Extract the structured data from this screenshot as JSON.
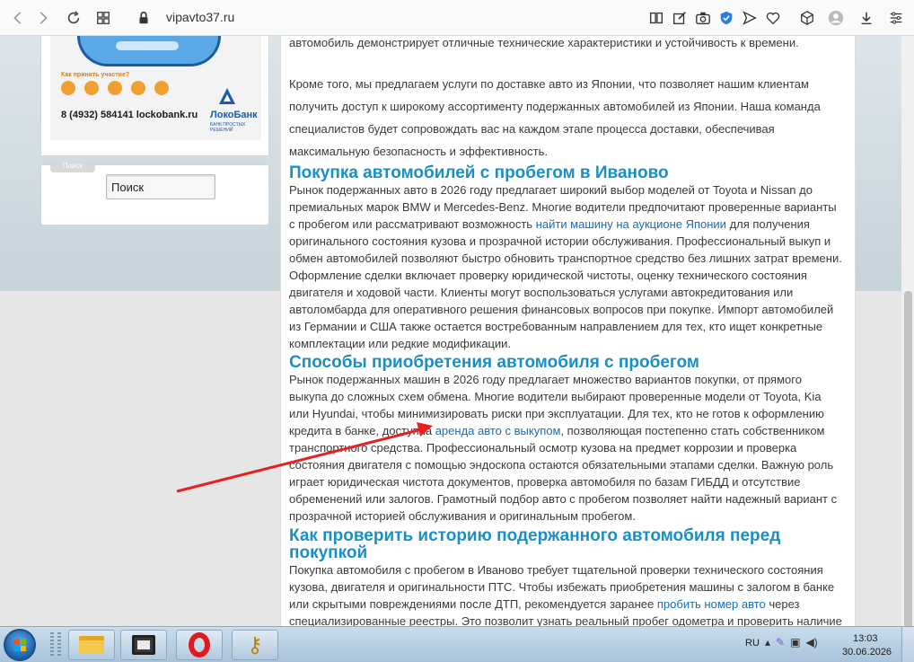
{
  "browser": {
    "url": "vipavto37.ru",
    "icons": [
      "back-icon",
      "forward-icon",
      "reload-icon",
      "tabs-grid-icon",
      "lock-icon",
      "reader-icon",
      "edit-icon",
      "camera-icon",
      "shield-icon",
      "send-icon",
      "heart-icon",
      "cube-icon",
      "profile-icon",
      "download-icon",
      "settings-icon"
    ]
  },
  "sidebar": {
    "banner": {
      "question": "Как принять участие?",
      "phone": "8 (4932) 584141 lockobank.ru",
      "bank_name": "ЛокоБанк",
      "bank_slogan": "БАНК ПРОСТЫХ РЕШЕНИЙ"
    },
    "search": {
      "tab_label": "Поиск",
      "placeholder": "Поиск"
    }
  },
  "article": {
    "intro_tail": "автомобиль демонстрирует отличные технические характеристики и устойчивость к времени.",
    "intro_para": "Кроме того, мы предлагаем услуги по доставке авто из Японии, что позволяет нашим клиентам получить доступ к широкому ассортименту подержанных автомобилей из Японии. Наша команда специалистов будет сопровождать вас на каждом этапе процесса доставки, обеспечивая максимальную безопасность и эффективность.",
    "sections": [
      {
        "title": "Покупка автомобилей с пробегом в Иваново",
        "text_before": "Рынок подержанных авто в 2026 году предлагает широкий выбор моделей от Toyota и Nissan до премиальных марок BMW и Mercedes-Benz. Многие водители предпочитают проверенные варианты с пробегом или рассматривают возможность ",
        "link": "найти машину на аукционе Японии",
        "text_after": " для получения оригинального состояния кузова и прозрачной истории обслуживания. Профессиональный выкуп и обмен автомобилей позволяют быстро обновить транспортное средство без лишних затрат времени. Оформление сделки включает проверку юридической чистоты, оценку технического состояния двигателя и ходовой части. Клиенты могут воспользоваться услугами автокредитования или автоломбарда для оперативного решения финансовых вопросов при покупке. Импорт автомобилей из Германии и США также остается востребованным направлением для тех, кто ищет конкретные комплектации или редкие модификации."
      },
      {
        "title": "Способы приобретения автомобиля с пробегом",
        "text_before": "Рынок подержанных машин в 2026 году предлагает множество вариантов покупки, от прямого выкупа до сложных схем обмена. Многие водители выбирают проверенные модели от Toyota, Kia или Hyundai, чтобы минимизировать риски при эксплуатации. Для тех, кто не готов к оформлению кредита в банке, доступна ",
        "link": "аренда авто с выкупом",
        "text_after": ", позволяющая постепенно стать собственником транспортного средства. Профессиональный осмотр кузова на предмет коррозии и проверка состояния двигателя с помощью эндоскопа остаются обязательными этапами сделки. Важную роль играет юридическая чистота документов, проверка автомобиля по базам ГИБДД и отсутствие обременений или залогов. Грамотный подбор авто с пробегом позволяет найти надежный вариант с прозрачной историей обслуживания и оригинальным пробегом."
      },
      {
        "title": "Как проверить историю подержанного автомобиля перед покупкой",
        "text_before": "Покупка автомобиля с пробегом в Иваново требует тщательной проверки технического состояния кузова, двигателя и оригинальности ПТС. Чтобы избежать приобретения машины с залогом в банке или скрытыми повреждениями после ДТП, рекомендуется заранее ",
        "link": "пробить номер авто",
        "text_after": " через специализированные реестры. Это позволит узнать реальный пробег одометра и проверить наличие ограничений на регистрационные действия в ГИБДД. Подобная проверка необходима"
      }
    ]
  },
  "annotation": {
    "arrow_color": "#e8201f"
  },
  "taskbar": {
    "language": "RU",
    "time": "13:03",
    "date": "30.06.2026",
    "apps": [
      "folder-icon",
      "monitor-icon",
      "opera-icon",
      "keys-icon"
    ]
  }
}
